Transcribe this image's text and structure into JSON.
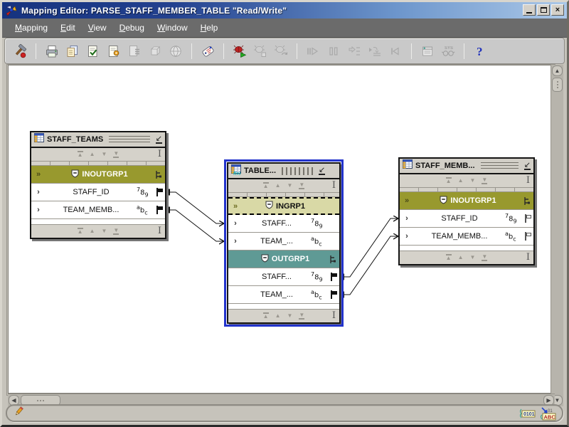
{
  "window": {
    "title": "Mapping Editor: PARSE_STAFF_MEMBER_TABLE \"Read/Write\"",
    "buttons": {
      "minimize": "minimize",
      "maximize": "maximize",
      "close": "close"
    }
  },
  "menu_bar": {
    "items": [
      {
        "label": "Mapping"
      },
      {
        "label": "Edit"
      },
      {
        "label": "View"
      },
      {
        "label": "Debug"
      },
      {
        "label": "Window"
      },
      {
        "label": "Help"
      }
    ]
  },
  "toolbar": {
    "items": [
      {
        "name": "toolbox",
        "enabled": true
      },
      {
        "separator": true
      },
      {
        "name": "print",
        "enabled": true
      },
      {
        "name": "copy",
        "enabled": true
      },
      {
        "name": "validate",
        "enabled": true
      },
      {
        "name": "generate",
        "enabled": true
      },
      {
        "name": "script",
        "enabled": false
      },
      {
        "name": "package",
        "enabled": false
      },
      {
        "name": "deploy",
        "enabled": false
      },
      {
        "separator": true
      },
      {
        "name": "tag",
        "enabled": true
      },
      {
        "separator": true
      },
      {
        "name": "debug-start",
        "enabled": true
      },
      {
        "name": "debug-stop",
        "enabled": false
      },
      {
        "name": "debug-restart",
        "enabled": false
      },
      {
        "separator": true
      },
      {
        "name": "resume",
        "enabled": false
      },
      {
        "name": "pause",
        "enabled": false
      },
      {
        "name": "step-into",
        "enabled": false
      },
      {
        "name": "step-over",
        "enabled": false
      },
      {
        "name": "rewind",
        "enabled": false
      },
      {
        "separator": true
      },
      {
        "name": "watch-window",
        "enabled": false
      },
      {
        "name": "inspector",
        "enabled": false
      },
      {
        "separator": true
      },
      {
        "name": "help",
        "enabled": true
      }
    ]
  },
  "canvas": {
    "boxes": [
      {
        "id": "staff_teams",
        "title": "STAFF_TEAMS",
        "selected": false,
        "grip": "horizontal",
        "icon": "table-icon",
        "rows": [
          {
            "kind": "group",
            "label": "INOUTGRP1",
            "direction": "inout",
            "chevron": "double",
            "connector": true
          },
          {
            "kind": "attr",
            "label": "STAFF_ID",
            "type": "number",
            "chevron": true,
            "flag": "solid"
          },
          {
            "kind": "attr",
            "label": "TEAM_MEMB...",
            "type": "string",
            "chevron": true,
            "flag": "solid"
          }
        ]
      },
      {
        "id": "table",
        "title": "TABLE...",
        "selected": true,
        "grip": "vertical",
        "icon": "table-fx-icon",
        "rows": [
          {
            "kind": "group",
            "label": "INGRP1",
            "direction": "in",
            "chevron": "double",
            "focused": true
          },
          {
            "kind": "attr",
            "label": "STAFF...",
            "type": "number",
            "chevron": true
          },
          {
            "kind": "attr",
            "label": "TEAM_...",
            "type": "string",
            "chevron": true
          },
          {
            "kind": "group",
            "label": "OUTGRP1",
            "direction": "out",
            "connector": true
          },
          {
            "kind": "attr",
            "label": "STAFF...",
            "type": "number",
            "flag": "solid"
          },
          {
            "kind": "attr",
            "label": "TEAM_...",
            "type": "string",
            "flag": "solid"
          }
        ]
      },
      {
        "id": "staff_memb",
        "title": "STAFF_MEMB...",
        "selected": false,
        "grip": "horizontal",
        "icon": "table-icon",
        "rows": [
          {
            "kind": "group",
            "label": "INOUTGRP1",
            "direction": "inout",
            "chevron": "double",
            "connector": true
          },
          {
            "kind": "attr",
            "label": "STAFF_ID",
            "type": "number",
            "chevron": true,
            "flag": "hollow"
          },
          {
            "kind": "attr",
            "label": "TEAM_MEMB...",
            "type": "string",
            "chevron": true,
            "flag": "hollow"
          }
        ]
      }
    ],
    "connections": [
      {
        "from": "STAFF_TEAMS.INOUTGRP1.STAFF_ID",
        "to": "TABLE.INGRP1.STAFF"
      },
      {
        "from": "STAFF_TEAMS.INOUTGRP1.TEAM_MEMB",
        "to": "TABLE.INGRP1.TEAM_"
      },
      {
        "from": "TABLE.OUTGRP1.STAFF",
        "to": "STAFF_MEMB.INOUTGRP1.STAFF_ID"
      },
      {
        "from": "TABLE.OUTGRP1.TEAM_",
        "to": "STAFF_MEMB.INOUTGRP1.TEAM_MEMB"
      }
    ]
  },
  "status_bar": {
    "left_icon": "pencil-icon",
    "indicators": [
      {
        "name": "binary-indicator",
        "label": "0101"
      },
      {
        "name": "abc-indicator",
        "label": "ABC"
      }
    ]
  },
  "colors": {
    "selection": "#2233cc",
    "group_inout": "#98992e",
    "group_in": "#d9d9a6",
    "group_out": "#5f9a95",
    "titlebar_left": "#16337f",
    "titlebar_right": "#abc8e8",
    "menubar": "#6b6b6b"
  }
}
